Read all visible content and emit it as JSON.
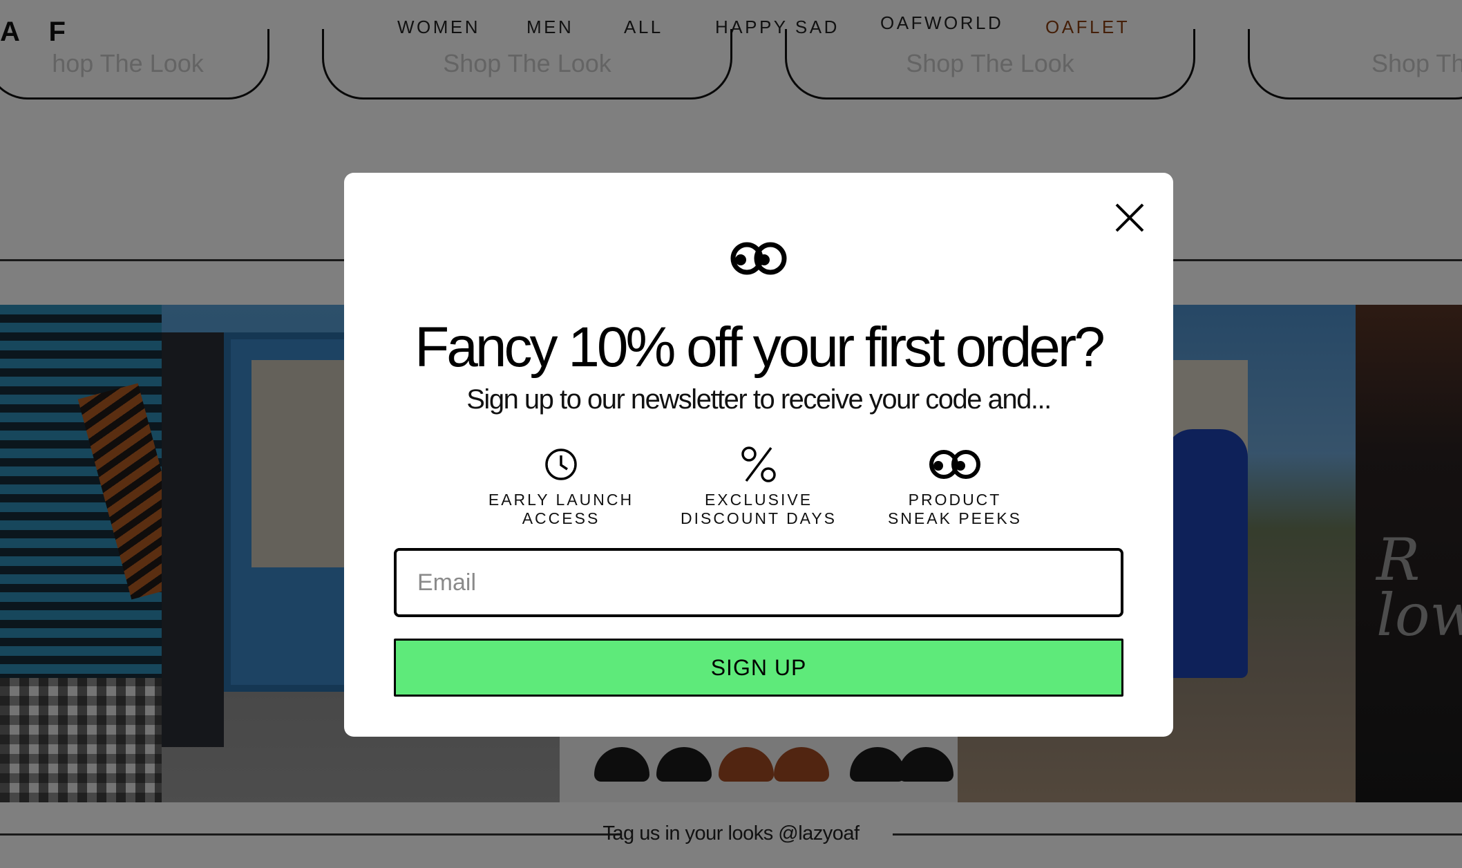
{
  "header": {
    "logo_text": "A F",
    "nav": [
      {
        "label": "WOMEN"
      },
      {
        "label": "MEN"
      },
      {
        "label": "ALL"
      },
      {
        "label": "HAPPY SAD"
      },
      {
        "label": "OAFWORLD"
      },
      {
        "label": "OAFLET"
      }
    ]
  },
  "looks": {
    "button_label": "Shop The Look",
    "button_label_clipped_left": "hop The Look",
    "button_label_clipped_right": "Shop Th"
  },
  "gallery": {
    "overlay_text": "R\nlow"
  },
  "footer": {
    "tag_text": "Tag us in your looks @lazyoaf"
  },
  "modal": {
    "headline": "Fancy 10% off your first order?",
    "subline": "Sign up to our newsletter to receive your code and...",
    "perks": [
      {
        "icon": "clock-icon",
        "label": "EARLY LAUNCH\nACCESS"
      },
      {
        "icon": "percent-icon",
        "label": "EXCLUSIVE\nDISCOUNT DAYS"
      },
      {
        "icon": "eyes-icon",
        "label": "PRODUCT\nSNEAK PEEKS"
      }
    ],
    "email_placeholder": "Email",
    "signup_label": "SIGN UP"
  },
  "colors": {
    "signup_green": "#5eea7a",
    "accent_nav": "#8b3f10",
    "overlay": "rgba(0,0,0,0.5)"
  }
}
